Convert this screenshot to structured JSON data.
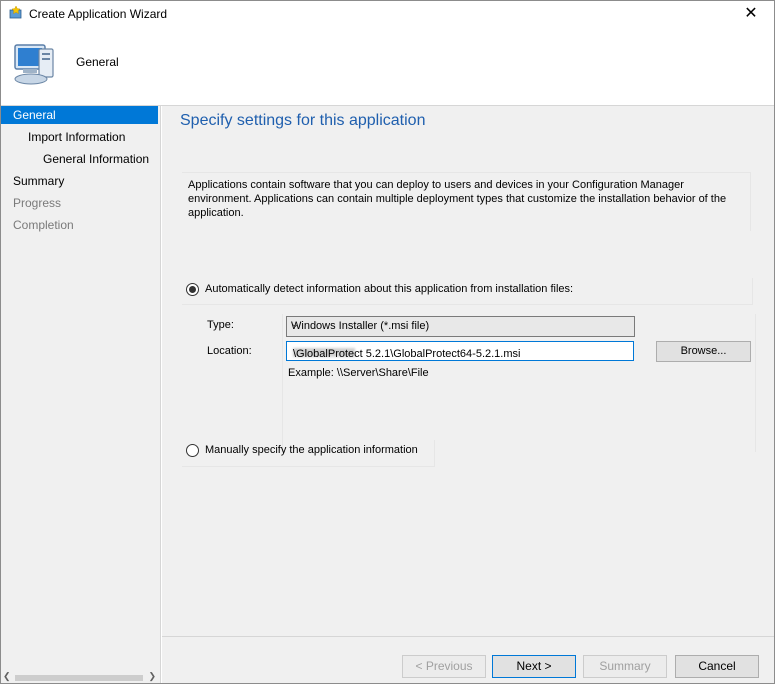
{
  "window": {
    "title": "Create Application Wizard"
  },
  "header": {
    "label": "General"
  },
  "sidebar": {
    "items": [
      {
        "label": "General",
        "state": "active"
      },
      {
        "label": "Import Information",
        "state": "normal"
      },
      {
        "label": "General Information",
        "state": "normal"
      },
      {
        "label": "Summary",
        "state": "normal"
      },
      {
        "label": "Progress",
        "state": "disabled"
      },
      {
        "label": "Completion",
        "state": "disabled"
      }
    ]
  },
  "main": {
    "title": "Specify settings for this application",
    "description": "Applications contain software that you can deploy to users and devices in your Configuration Manager environment. Applications can contain multiple deployment types that customize the installation behavior of the application.",
    "auto_detect": {
      "label": "Automatically detect information about this application from installation files:",
      "selected": true
    },
    "type_label": "Type:",
    "type_value": "Windows Installer (*.msi file)",
    "location_label": "Location:",
    "location_prefix": "\\\\",
    "location_value": "\\GlobalProtect 5.2.1\\GlobalProtect64-5.2.1.msi",
    "browse_label": "Browse...",
    "example": "Example: \\\\Server\\Share\\File",
    "manual": {
      "label": "Manually specify the application information",
      "selected": false
    }
  },
  "footer": {
    "previous": "< Previous",
    "next": "Next >",
    "summary": "Summary",
    "cancel": "Cancel"
  },
  "colors": {
    "accent": "#0078d7",
    "title_blue": "#1f5fae"
  }
}
